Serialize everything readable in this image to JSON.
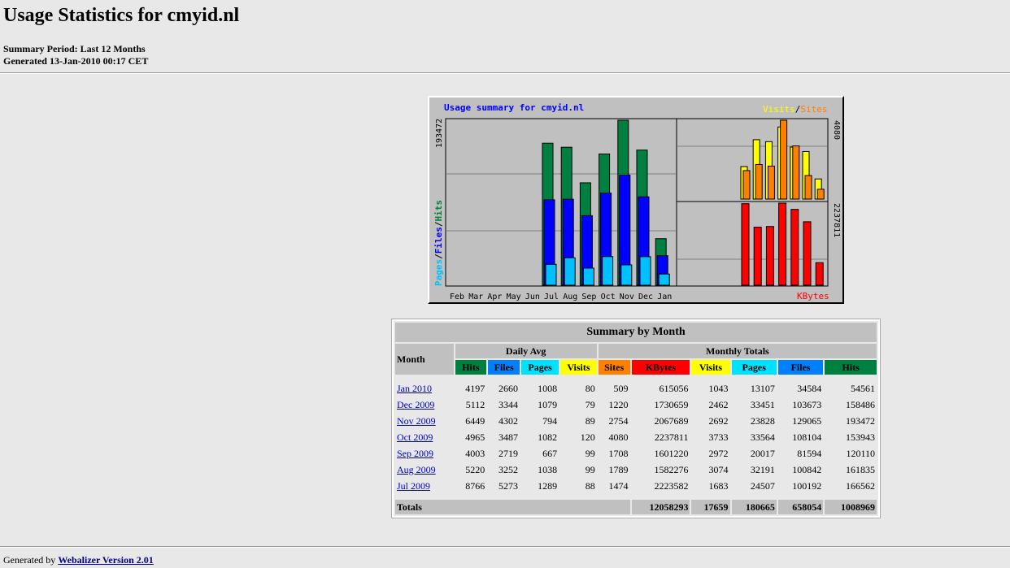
{
  "page": {
    "title": "Usage Statistics for cmyid.nl",
    "summary_period": "Summary Period: Last 12 Months",
    "generated": "Generated 13-Jan-2010 00:17 CET",
    "footer_prefix": "Generated by",
    "footer_link": "Webalizer Version 2.01"
  },
  "graph": {
    "title": "Usage summary for cmyid.nl",
    "legend_visits": "Visits",
    "legend_sep": "/",
    "legend_sites": "Sites",
    "left_axis_max": "193472",
    "left_legend_pages": "Pages",
    "left_legend_files": "Files",
    "left_legend_hits": "Hits",
    "right_top_max": "4080",
    "right_bottom_max": "2237811",
    "kbytes_label": "KBytes",
    "colors": {
      "hits": "#008040",
      "files": "#0000ff",
      "pages": "#00c0ff",
      "visits": "#ffff00",
      "sites": "#ff8000",
      "kbytes": "#ff0000",
      "title": "#0000ff"
    }
  },
  "chart_data": {
    "type": "bar",
    "title": "Usage summary for cmyid.nl",
    "categories": [
      "Feb",
      "Mar",
      "Apr",
      "May",
      "Jun",
      "Jul",
      "Aug",
      "Sep",
      "Oct",
      "Nov",
      "Dec",
      "Jan"
    ],
    "series": [
      {
        "name": "Hits",
        "values": [
          0,
          0,
          0,
          0,
          0,
          166562,
          161835,
          120110,
          153943,
          193472,
          158486,
          54561
        ]
      },
      {
        "name": "Files",
        "values": [
          0,
          0,
          0,
          0,
          0,
          100192,
          100842,
          81594,
          108104,
          129065,
          103673,
          34584
        ]
      },
      {
        "name": "Pages",
        "values": [
          0,
          0,
          0,
          0,
          0,
          24507,
          32191,
          20017,
          33564,
          23828,
          33451,
          13107
        ]
      },
      {
        "name": "Visits",
        "values": [
          0,
          0,
          0,
          0,
          0,
          1683,
          3074,
          2972,
          3733,
          2692,
          2462,
          1043
        ]
      },
      {
        "name": "Sites",
        "values": [
          0,
          0,
          0,
          0,
          0,
          1474,
          1789,
          1708,
          4080,
          2754,
          1220,
          509
        ]
      },
      {
        "name": "KBytes",
        "values": [
          0,
          0,
          0,
          0,
          0,
          2223582,
          1582276,
          1601220,
          2237811,
          2067689,
          1730659,
          615056
        ]
      }
    ],
    "left_ylim": [
      0,
      193472
    ],
    "visits_sites_ylim": [
      0,
      4080
    ],
    "kbytes_ylim": [
      0,
      2237811
    ]
  },
  "table": {
    "caption": "Summary by Month",
    "month_header": "Month",
    "daily_avg_header": "Daily Avg",
    "monthly_totals_header": "Monthly Totals",
    "daily_cols": [
      "Hits",
      "Files",
      "Pages",
      "Visits"
    ],
    "monthly_cols": [
      "Sites",
      "KBytes",
      "Visits",
      "Pages",
      "Files",
      "Hits"
    ],
    "rows": [
      {
        "month": "Jan 2010",
        "cells": [
          "4197",
          "2660",
          "1008",
          "80",
          "509",
          "615056",
          "1043",
          "13107",
          "34584",
          "54561"
        ]
      },
      {
        "month": "Dec 2009",
        "cells": [
          "5112",
          "3344",
          "1079",
          "79",
          "1220",
          "1730659",
          "2462",
          "33451",
          "103673",
          "158486"
        ]
      },
      {
        "month": "Nov 2009",
        "cells": [
          "6449",
          "4302",
          "794",
          "89",
          "2754",
          "2067689",
          "2692",
          "23828",
          "129065",
          "193472"
        ]
      },
      {
        "month": "Oct 2009",
        "cells": [
          "4965",
          "3487",
          "1082",
          "120",
          "4080",
          "2237811",
          "3733",
          "33564",
          "108104",
          "153943"
        ]
      },
      {
        "month": "Sep 2009",
        "cells": [
          "4003",
          "2719",
          "667",
          "99",
          "1708",
          "1601220",
          "2972",
          "20017",
          "81594",
          "120110"
        ]
      },
      {
        "month": "Aug 2009",
        "cells": [
          "5220",
          "3252",
          "1038",
          "99",
          "1789",
          "1582276",
          "3074",
          "32191",
          "100842",
          "161835"
        ]
      },
      {
        "month": "Jul 2009",
        "cells": [
          "8766",
          "5273",
          "1289",
          "88",
          "1474",
          "2223582",
          "1683",
          "24507",
          "100192",
          "166562"
        ]
      }
    ],
    "totals_label": "Totals",
    "totals": [
      "12058293",
      "17659",
      "180665",
      "658054",
      "1008969"
    ]
  }
}
